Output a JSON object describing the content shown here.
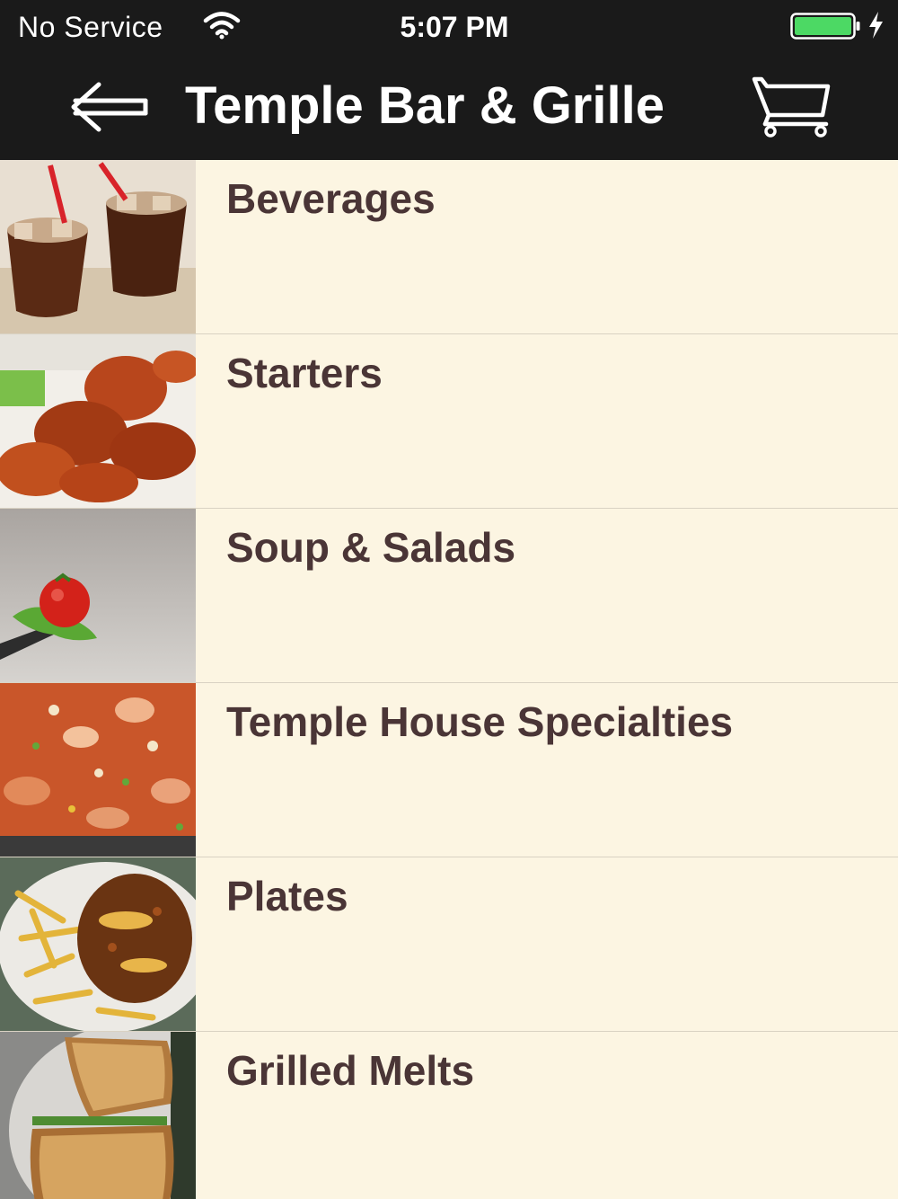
{
  "status_bar": {
    "carrier": "No Service",
    "time": "5:07 PM",
    "battery_color": "#4cd964"
  },
  "nav": {
    "title": "Temple Bar & Grille",
    "back_icon": "back-arrow-icon",
    "cart_icon": "shopping-cart-icon"
  },
  "menu": {
    "categories": [
      {
        "label": "Beverages",
        "image": "iced-cola-drinks-photo"
      },
      {
        "label": "Starters",
        "image": "buffalo-wings-photo"
      },
      {
        "label": "Soup & Salads",
        "image": "tomato-lettuce-on-fork-photo"
      },
      {
        "label": "Temple House Specialties",
        "image": "jambalaya-photo"
      },
      {
        "label": "Plates",
        "image": "chili-cheese-fries-photo"
      },
      {
        "label": "Grilled Melts",
        "image": "grilled-toast-photo"
      }
    ]
  },
  "colors": {
    "bar_background": "#1a1a1a",
    "list_background": "#fcf5e2",
    "label_color": "#4a3536",
    "divider": "#d9d2c3"
  }
}
